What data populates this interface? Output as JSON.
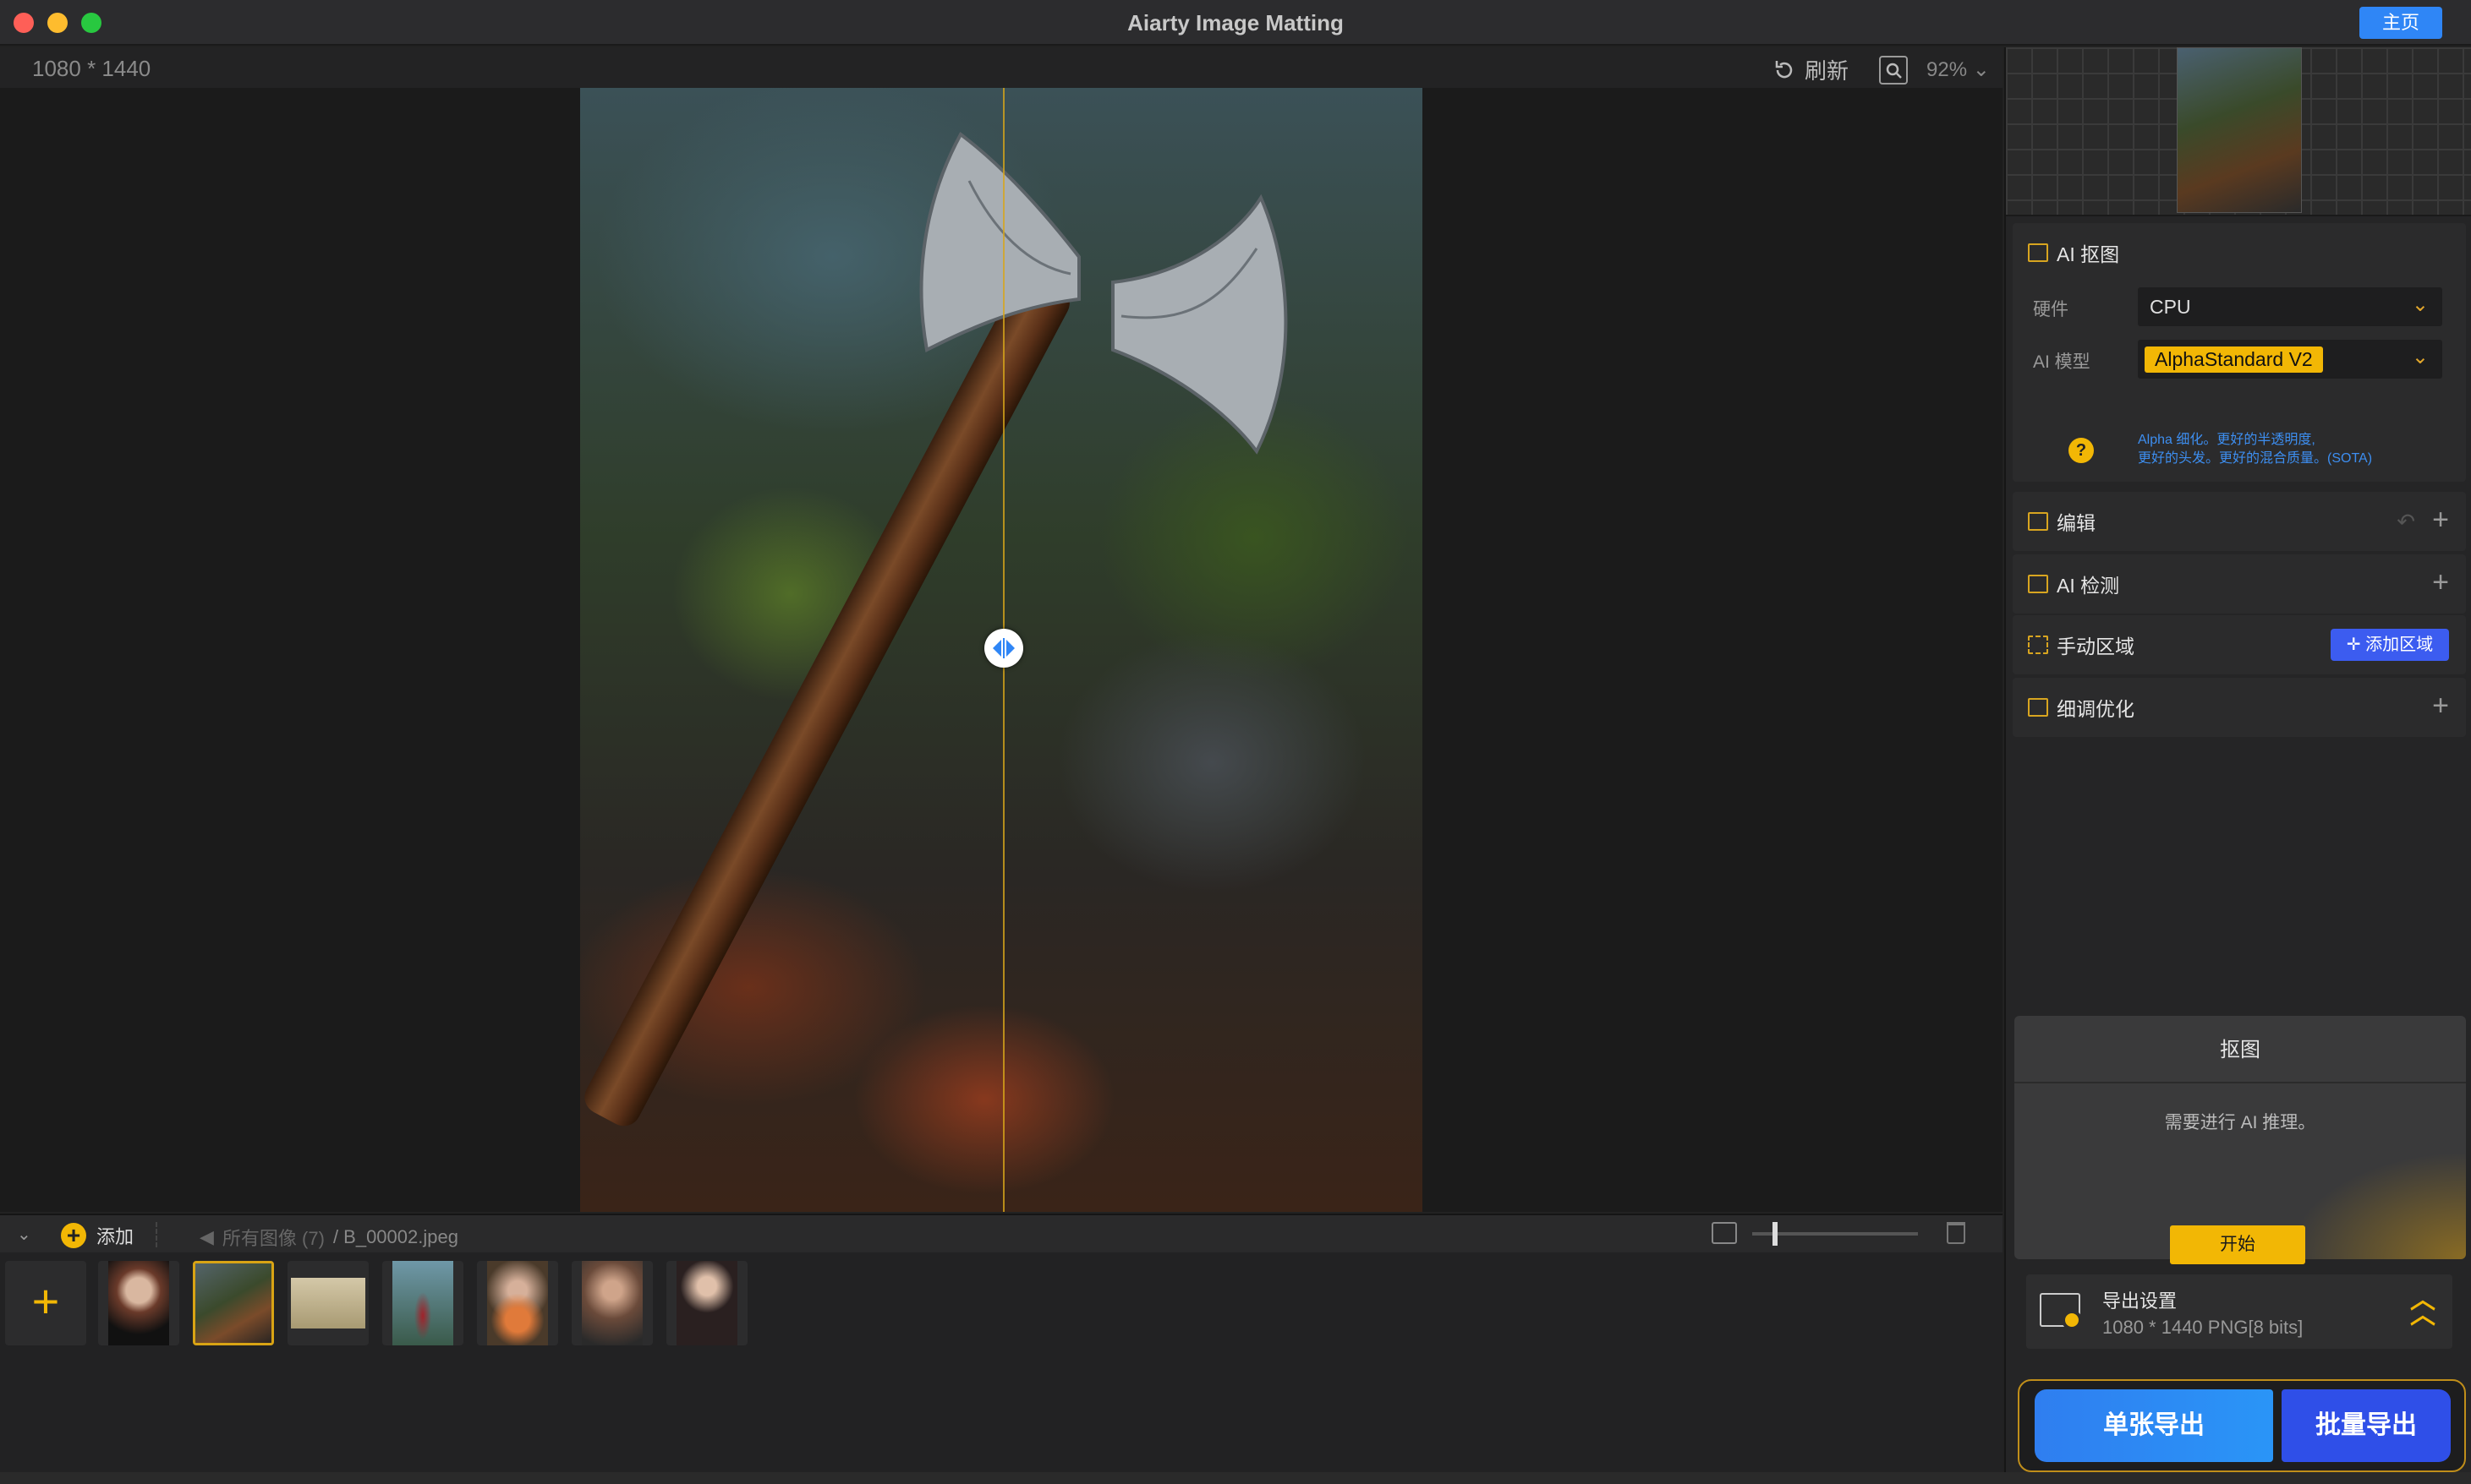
{
  "window": {
    "title": "Aiarty Image Matting",
    "home_label": "主页"
  },
  "toolbar": {
    "image_size": "1080 * 1440",
    "refresh_label": "刷新",
    "zoom": "92%"
  },
  "canvas": {
    "split_position_fraction": 0.5
  },
  "filmstrip": {
    "add_label": "添加",
    "breadcrumb_all": "所有图像 (7)",
    "breadcrumb_current": "/ B_00002.jpeg",
    "thumbnails": [
      {
        "name": "jellyfish"
      },
      {
        "name": "axe",
        "selected": true
      },
      {
        "name": "bicycle"
      },
      {
        "name": "woman-red-dress"
      },
      {
        "name": "woman-flowers"
      },
      {
        "name": "woman-portrait"
      },
      {
        "name": "woman-lace"
      }
    ]
  },
  "panel": {
    "ai_matting": {
      "title": "AI 抠图",
      "hardware_label": "硬件",
      "hardware_value": "CPU",
      "model_label": "AI 模型",
      "model_value": "AlphaStandard  V2",
      "help_icon": "?",
      "model_desc_line1": "Alpha 细化。更好的半透明度,",
      "model_desc_line2": "更好的头发。更好的混合质量。(SOTA)"
    },
    "edit_title": "编辑",
    "ai_detect_title": "AI 检测",
    "manual_area_title": "手动区域",
    "add_area_label": "添加区域",
    "refine_title": "细调优化",
    "matting_card": {
      "title": "抠图",
      "message": "需要进行 AI 推理。",
      "start_label": "开始"
    },
    "export_settings": {
      "title": "导出设置",
      "detail": "1080 * 1440 PNG[8 bits]"
    },
    "export_single": "单张导出",
    "export_batch": "批量导出"
  },
  "colors": {
    "accent": "#f2b705",
    "primary_blue": "#2f86f6",
    "batch_blue": "#2f4fe8"
  }
}
